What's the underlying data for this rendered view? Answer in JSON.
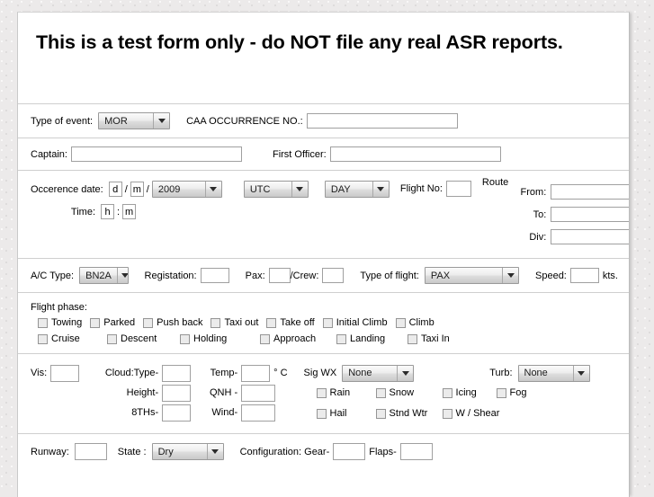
{
  "header": {
    "title": "This is a test form only - do NOT file any real ASR reports."
  },
  "event": {
    "type_label": "Type of event:",
    "type_value": "MOR",
    "caa_label": "CAA OCCURRENCE NO.:",
    "caa_value": ""
  },
  "crew": {
    "captain_label": "Captain:",
    "captain_value": "",
    "first_officer_label": "First Officer:",
    "first_officer_value": ""
  },
  "occurrence": {
    "date_label": "Occerence date:",
    "day_value": "d",
    "sep1": "/",
    "month_value": "m",
    "sep2": "/",
    "year_value": "2009",
    "timezone_value": "UTC",
    "daynight_value": "DAY",
    "time_label": "Time:",
    "hour_value": "h",
    "time_sep": ":",
    "minute_value": "m",
    "flight_no_label": "Flight No:",
    "flight_no_value": "",
    "route_label": "Route",
    "from_label": "From:",
    "from_value": "",
    "to_label": "To:",
    "to_value": "",
    "div_label": "Div:",
    "div_value": ""
  },
  "aircraft": {
    "ac_type_label": "A/C Type:",
    "ac_type_value": "BN2A",
    "registration_label": "Registation:",
    "registration_value": "",
    "pax_label": "Pax:",
    "pax_value": "",
    "crew_label": "/Crew:",
    "crew_value": "",
    "flight_type_label": "Type of flight:",
    "flight_type_value": "PAX",
    "speed_label": "Speed:",
    "speed_value": "",
    "speed_units": "kts."
  },
  "flight_phase": {
    "title": "Flight phase:",
    "row1": [
      "Towing",
      "Parked",
      "Push back",
      "Taxi out",
      "Take off",
      "Initial Climb",
      "Climb"
    ],
    "row2": [
      "Cruise",
      "Descent",
      "Holding",
      "Approach",
      "Landing",
      "Taxi In"
    ]
  },
  "weather": {
    "vis_label": "Vis:",
    "vis_value": "",
    "cloud_type_label": "Cloud:Type-",
    "cloud_type_value": "",
    "cloud_height_label": "Height-",
    "cloud_height_value": "",
    "cloud_8ths_label": "8THs-",
    "cloud_8ths_value": "",
    "temp_label": "Temp-",
    "temp_value": "",
    "temp_units": "° C",
    "qnh_label": "QNH -",
    "qnh_value": "",
    "wind_label": "Wind-",
    "wind_value": "",
    "sigwx_label": "Sig WX",
    "sigwx_value": "None",
    "turb_label": "Turb:",
    "turb_value": "None",
    "sigwx_row1": [
      "Rain",
      "Snow",
      "Icing",
      "Fog"
    ],
    "sigwx_row2": [
      "Hail",
      "Stnd Wtr",
      "W / Shear"
    ]
  },
  "runway": {
    "runway_label": "Runway:",
    "runway_value": "",
    "state_label": "State :",
    "state_value": "Dry",
    "config_label": "Configuration: Gear-",
    "gear_value": "",
    "flaps_label": "Flaps-",
    "flaps_value": ""
  },
  "icons": {
    "dropdown_arrow": "chevron-down-icon"
  },
  "colors": {
    "page_background": "#ffffff",
    "desktop_background": "#eceaea",
    "divider": "#cfcfcf",
    "input_border": "#a0a0a0",
    "checkbox_fill": "#ebebeb"
  }
}
